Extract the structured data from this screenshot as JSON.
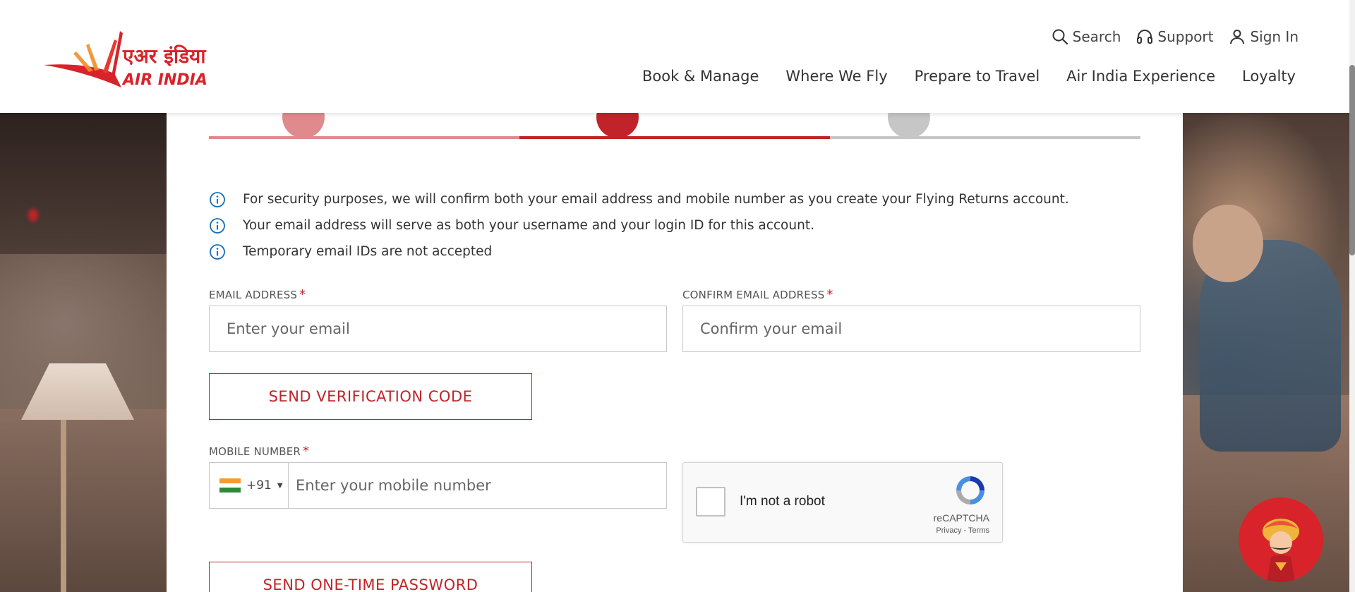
{
  "brand": {
    "hindi": "एअर इंडिया",
    "english": "AIR INDIA",
    "red": "#d8232a"
  },
  "header": {
    "util": [
      {
        "label": "Search",
        "icon": "search-icon"
      },
      {
        "label": "Support",
        "icon": "headset-icon"
      },
      {
        "label": "Sign In",
        "icon": "user-icon"
      }
    ],
    "nav": [
      "Book & Manage",
      "Where We Fly",
      "Prepare to Travel",
      "Air India Experience",
      "Loyalty"
    ]
  },
  "notes": [
    "For security purposes, we will confirm both your email address and mobile number as you create your Flying Returns account.",
    "Your email address will serve as both your username and your login ID for this account.",
    "Temporary email IDs are not accepted"
  ],
  "form": {
    "email_label": "EMAIL ADDRESS",
    "email_placeholder": "Enter your email",
    "confirm_label": "CONFIRM EMAIL ADDRESS",
    "confirm_placeholder": "Confirm your email",
    "required_mark": "*",
    "send_code_button": "SEND VERIFICATION CODE",
    "mobile_label": "MOBILE NUMBER",
    "dial_code": "+91",
    "mobile_placeholder": "Enter your mobile number",
    "send_otp_button": "SEND ONE-TIME PASSWORD"
  },
  "captcha": {
    "label": "I'm not a robot",
    "brand": "reCAPTCHA",
    "privacy": "Privacy",
    "separator": " - ",
    "terms": "Terms"
  }
}
